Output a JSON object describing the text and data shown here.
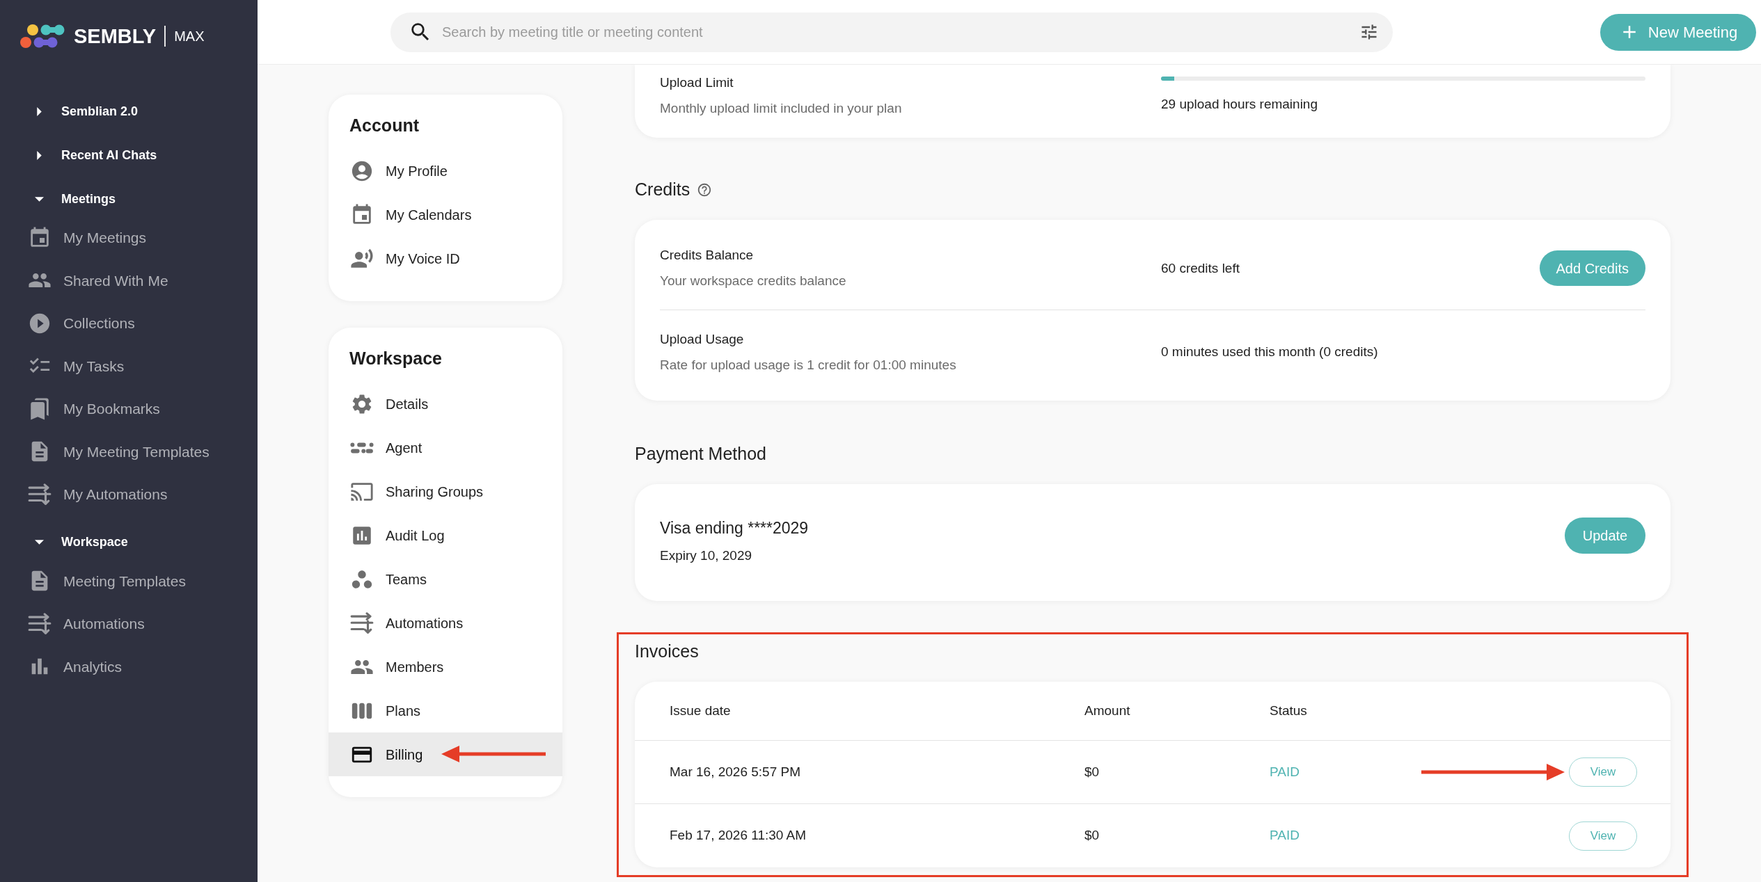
{
  "sidebar": {
    "logo": {
      "name": "SEMBLY",
      "plan": "MAX"
    },
    "sections": [
      {
        "title": "Semblian 2.0",
        "expanded": false
      },
      {
        "title": "Recent AI Chats",
        "expanded": false
      },
      {
        "title": "Meetings",
        "expanded": true,
        "items": [
          {
            "label": "My Meetings"
          },
          {
            "label": "Shared With Me"
          },
          {
            "label": "Collections"
          },
          {
            "label": "My Tasks"
          },
          {
            "label": "My Bookmarks"
          },
          {
            "label": "My Meeting Templates"
          },
          {
            "label": "My Automations"
          }
        ]
      },
      {
        "title": "Workspace",
        "expanded": true,
        "items": [
          {
            "label": "Meeting Templates"
          },
          {
            "label": "Automations"
          },
          {
            "label": "Analytics"
          }
        ]
      }
    ]
  },
  "header": {
    "search": {
      "placeholder": "Search by meeting title or meeting content"
    },
    "new_meeting_button": "New Meeting"
  },
  "settings_nav": [
    {
      "title": "Account",
      "items": [
        {
          "label": "My Profile",
          "selected": false,
          "callout_arrow": false
        },
        {
          "label": "My Calendars",
          "selected": false,
          "callout_arrow": false
        },
        {
          "label": "My Voice ID",
          "selected": false,
          "callout_arrow": false
        }
      ]
    },
    {
      "title": "Workspace",
      "items": [
        {
          "label": "Details",
          "selected": false,
          "callout_arrow": false
        },
        {
          "label": "Agent",
          "selected": false,
          "callout_arrow": false
        },
        {
          "label": "Sharing Groups",
          "selected": false,
          "callout_arrow": false
        },
        {
          "label": "Audit Log",
          "selected": false,
          "callout_arrow": false
        },
        {
          "label": "Teams",
          "selected": false,
          "callout_arrow": false
        },
        {
          "label": "Automations",
          "selected": false,
          "callout_arrow": false
        },
        {
          "label": "Members",
          "selected": false,
          "callout_arrow": false
        },
        {
          "label": "Plans",
          "selected": false,
          "callout_arrow": false
        },
        {
          "label": "Billing",
          "selected": true,
          "callout_arrow": true
        }
      ]
    }
  ],
  "upload_limit": {
    "title": "Upload Limit",
    "description": "Monthly upload limit included in your plan",
    "level": 0.027,
    "reading": "29 upload hours remaining"
  },
  "credits": {
    "heading": "Credits",
    "rows": [
      {
        "title": "Credits Balance",
        "description": "Your workspace credits balance",
        "value": "60 credits left",
        "button": "Add Credits"
      },
      {
        "title": "Upload Usage",
        "description": "Rate for upload usage is 1 credit for 01:00 minutes",
        "value": "0 minutes used this month (0 credits)"
      }
    ]
  },
  "payment_method": {
    "heading": "Payment Method",
    "card": "Visa ending ****2029",
    "expiry": "Expiry 10, 2029",
    "button": "Update"
  },
  "invoices": {
    "heading": "Invoices",
    "highlighted": true,
    "columns": [
      "Issue date",
      "Amount",
      "Status"
    ],
    "rows": [
      {
        "issue_date": "Mar 16, 2026 5:57 PM",
        "amount": "$0",
        "status": "PAID",
        "action": "View",
        "callout_arrow": true
      },
      {
        "issue_date": "Feb 17, 2026 11:30 AM",
        "amount": "$0",
        "status": "PAID",
        "action": "View",
        "callout_arrow": false
      }
    ]
  }
}
